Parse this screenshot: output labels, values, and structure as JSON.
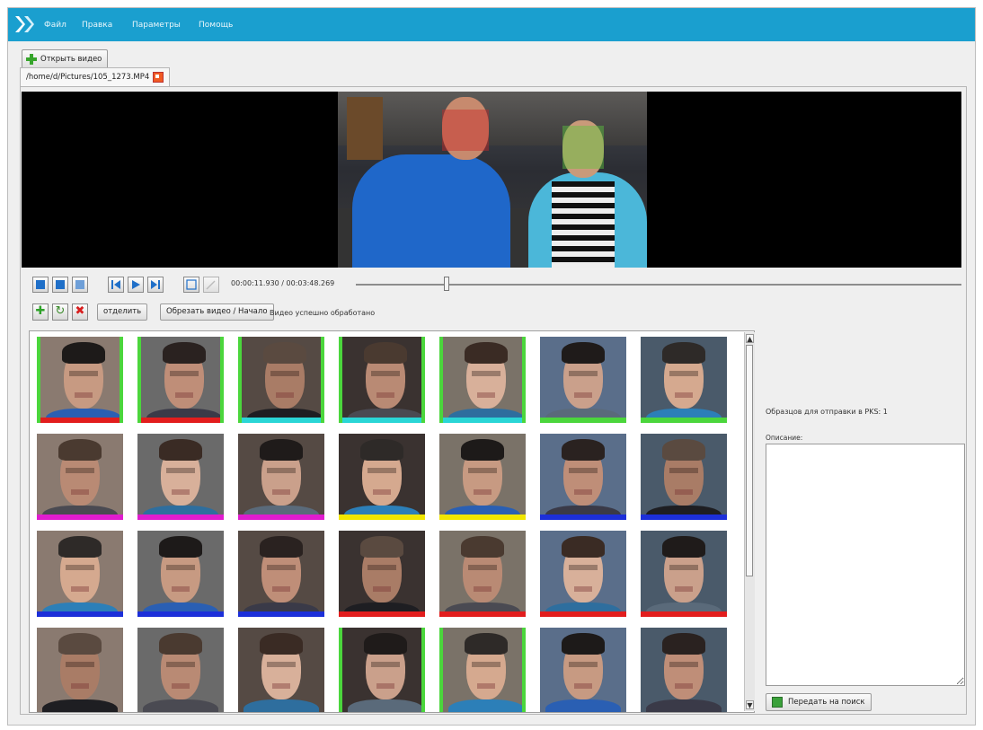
{
  "menu": {
    "file": "Файл",
    "edit": "Правка",
    "params": "Параметры",
    "help": "Помощь"
  },
  "toolbar": {
    "open_video": "Открыть видео"
  },
  "tab": {
    "path": "/home/d/Pictures/105_1273.MP4"
  },
  "player": {
    "time": "00:00:11.930 / 00:03:48.269",
    "progress": 0.15
  },
  "actions": {
    "separate": "отделить",
    "cut": "Обрезать видео / Начало",
    "status": "Видео успешно обработано"
  },
  "right": {
    "samples": "Образцов для отправки в PKS: 1",
    "description_label": "Описание:",
    "send": "Передать на поиск"
  },
  "colors": {
    "menubar": "#1a9fcf",
    "green": "#4bd63c",
    "red": "#e21d1d",
    "cyan": "#2ad6d6",
    "magenta": "#e01ccf",
    "yellow": "#f1e600",
    "blue": "#1c2fd9"
  },
  "thumbs": [
    [
      "green",
      "red"
    ],
    [
      "green",
      "red"
    ],
    [
      "green",
      "cyan"
    ],
    [
      "green",
      "cyan"
    ],
    [
      "green",
      "cyan"
    ],
    [
      "none",
      "green"
    ],
    [
      "none",
      "green"
    ],
    [
      "none",
      "magenta"
    ],
    [
      "none",
      "magenta"
    ],
    [
      "none",
      "magenta"
    ],
    [
      "none",
      "yellow"
    ],
    [
      "none",
      "yellow"
    ],
    [
      "none",
      "blue"
    ],
    [
      "none",
      "blue"
    ],
    [
      "none",
      "blue"
    ],
    [
      "none",
      "blue"
    ],
    [
      "none",
      "blue"
    ],
    [
      "none",
      "red"
    ],
    [
      "none",
      "red"
    ],
    [
      "none",
      "red"
    ],
    [
      "none",
      "red"
    ],
    [
      "none",
      "none"
    ],
    [
      "none",
      "none"
    ],
    [
      "none",
      "none"
    ],
    [
      "green",
      "none"
    ],
    [
      "green",
      "none"
    ],
    [
      "none",
      "none"
    ],
    [
      "none",
      "none"
    ]
  ]
}
